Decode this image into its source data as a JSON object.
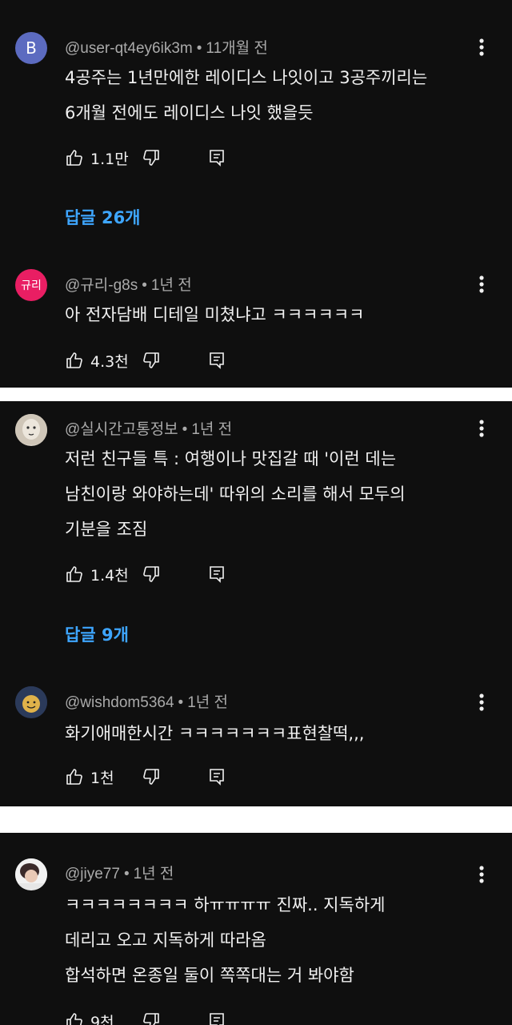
{
  "comments": [
    {
      "avatar_letter": "B",
      "avatar_color": "#5c6bc0",
      "handle": "@user-qt4ey6ik3m",
      "time": "11개월 전",
      "lines": [
        "4공주는 1년만에한 레이디스 나잇이고 3공주끼리는",
        "6개월 전에도 레이디스 나잇 했을듯"
      ],
      "likes": "1.1만",
      "replies_label": "답글 26개"
    },
    {
      "avatar_text": "규리",
      "avatar_color": "#e91e63",
      "handle": "@규리-g8s",
      "time": "1년 전",
      "lines": [
        "아 전자담배 디테일 미쳤냐고 ㅋㅋㅋㅋㅋㅋ"
      ],
      "likes": "4.3천"
    },
    {
      "handle": "@실시간고통정보",
      "time": "1년 전",
      "lines": [
        "저런 친구들 특 : 여행이나 맛집갈 때 '이런 데는",
        "남친이랑 와야하는데' 따위의 소리를 해서 모두의",
        "기분을 조짐"
      ],
      "likes": "1.4천",
      "replies_label": "답글 9개"
    },
    {
      "handle": "@wishdom5364",
      "time": "1년 전",
      "lines": [
        "화기애매한시간 ㅋㅋㅋㅋㅋㅋㅋ표현찰떡,,,"
      ],
      "likes": "1천"
    },
    {
      "handle": "@jiye77",
      "time": "1년 전",
      "lines": [
        "ㅋㅋㅋㅋㅋㅋㅋㅋ 하ㅠㅠㅠㅠ 진짜.. 지독하게",
        "데리고 오고 지독하게 따라옴",
        "합석하면 온종일 둘이 쪽쪽대는 거 봐야함"
      ],
      "likes": "9천"
    }
  ],
  "dot": "•",
  "colors": {
    "background": "#0f0f0f",
    "text": "#f1f1f1",
    "meta": "#aaaaaa",
    "link": "#3ea6ff",
    "divider": "#ffffff"
  },
  "icons": {
    "like": "thumb-up-icon",
    "dislike": "thumb-down-icon",
    "reply": "reply-comment-icon",
    "more": "more-vert-icon"
  }
}
